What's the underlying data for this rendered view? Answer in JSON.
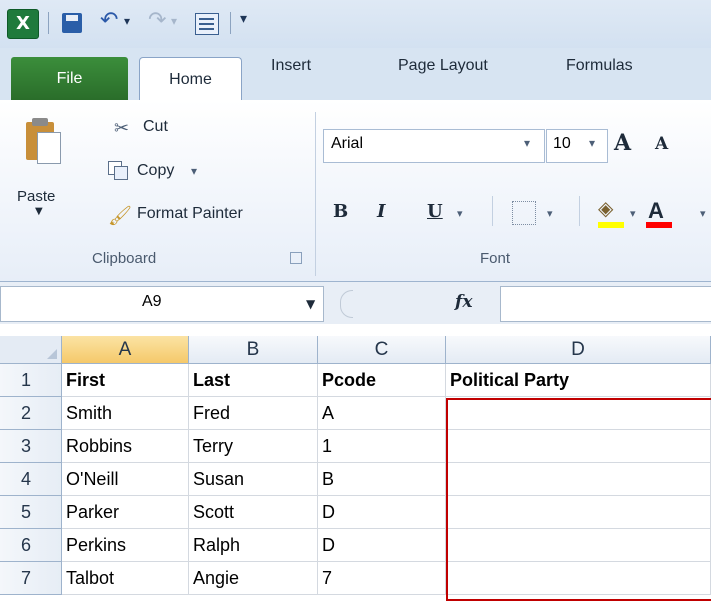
{
  "app": {
    "logo_letter": "X",
    "custom_qat_glyph": "▾",
    "colors": {
      "file_tab": "#2a7a2a",
      "highlight": "#c00000",
      "active_header": "#f5c96a"
    }
  },
  "tabs": {
    "file": "File",
    "home": "Home",
    "items": [
      "Insert",
      "Page Layout",
      "Formulas"
    ]
  },
  "ribbon": {
    "clipboard": {
      "paste": "Paste",
      "cut": "Cut",
      "copy": "Copy",
      "format_painter": "Format Painter",
      "label": "Clipboard"
    },
    "font": {
      "name": "Arial",
      "size": "10",
      "grow": "A",
      "shrink": "A",
      "bold": "B",
      "italic": "I",
      "underline": "U",
      "font_color": "A",
      "label": "Font"
    }
  },
  "formula_bar": {
    "name_box": "A9",
    "fx": "fx",
    "value": ""
  },
  "sheet": {
    "columns": [
      "A",
      "B",
      "C",
      "D"
    ],
    "rows": [
      "1",
      "2",
      "3",
      "4",
      "5",
      "6",
      "7"
    ],
    "cells": [
      [
        "First",
        "Last",
        "Pcode",
        "Political Party"
      ],
      [
        "Smith",
        "Fred",
        "A",
        ""
      ],
      [
        "Robbins",
        "Terry",
        "1",
        ""
      ],
      [
        "O'Neill",
        "Susan",
        "B",
        ""
      ],
      [
        "Parker",
        "Scott",
        "D",
        ""
      ],
      [
        "Perkins",
        "Ralph",
        "D",
        ""
      ],
      [
        "Talbot",
        "Angie",
        "7",
        ""
      ]
    ]
  }
}
